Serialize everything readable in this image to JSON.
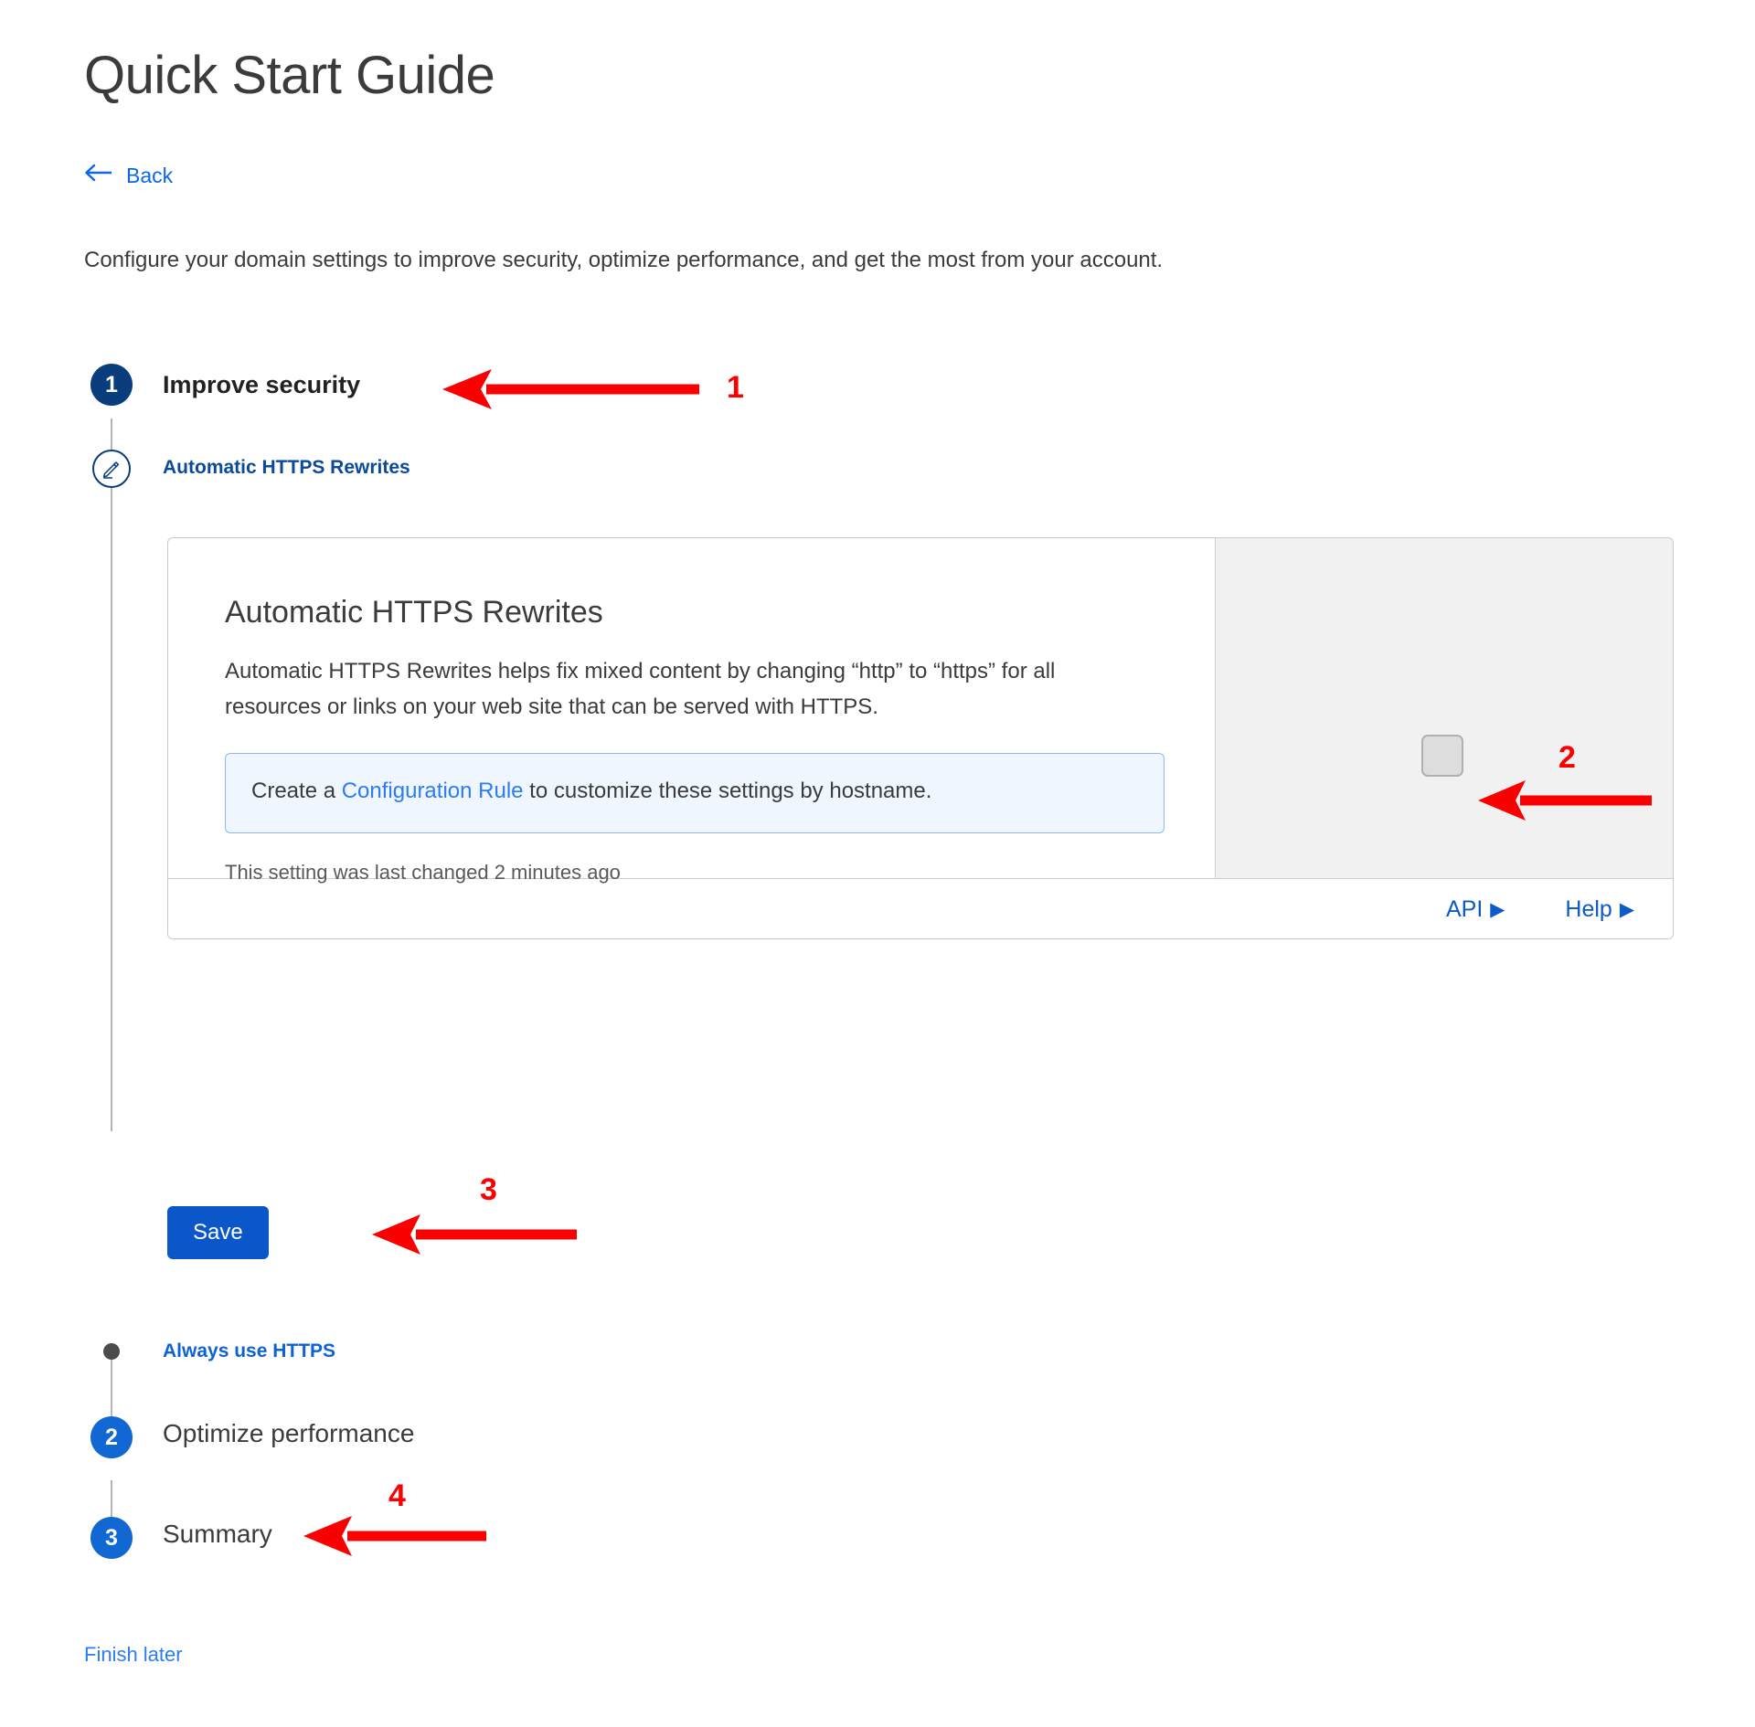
{
  "header": {
    "title": "Quick Start Guide",
    "back_label": "Back",
    "back_icon": "arrow-left-icon",
    "intro": "Configure your domain settings to improve security, optimize performance, and get the most from your account."
  },
  "steps": [
    {
      "number": "1",
      "label": "Improve security",
      "badge_color": "#0a3d7c"
    },
    {
      "number": "2",
      "label": "Optimize performance",
      "badge_color": "#1168d2"
    },
    {
      "number": "3",
      "label": "Summary",
      "badge_color": "#1168d2"
    }
  ],
  "substeps": [
    {
      "label": "Automatic HTTPS Rewrites",
      "icon": "pencil-icon"
    },
    {
      "label": "Always use HTTPS",
      "icon": "dot-icon"
    }
  ],
  "card": {
    "heading": "Automatic HTTPS Rewrites",
    "description": "Automatic HTTPS Rewrites helps fix mixed content by changing “http” to “https” for all resources or links on your web site that can be served with HTTPS.",
    "info_prefix": "Create a ",
    "info_link": "Configuration Rule",
    "info_suffix": " to customize these settings by hostname.",
    "last_changed": "This setting was last changed 2 minutes ago",
    "toggle": {
      "name": "automatic-https-rewrites-toggle",
      "state": "off"
    },
    "footer": {
      "api_label": "API",
      "help_label": "Help",
      "caret": "▶"
    }
  },
  "actions": {
    "save_label": "Save",
    "save_color": "#0b57c9",
    "finish_later_label": "Finish later"
  },
  "annotations": {
    "color": "#fb0000",
    "markers": [
      {
        "id": "1",
        "label": "1",
        "target": "improve-security-step"
      },
      {
        "id": "2",
        "label": "2",
        "target": "automatic-https-rewrites-toggle"
      },
      {
        "id": "3",
        "label": "3",
        "target": "save-button"
      },
      {
        "id": "4",
        "label": "4",
        "target": "summary-step"
      }
    ]
  }
}
